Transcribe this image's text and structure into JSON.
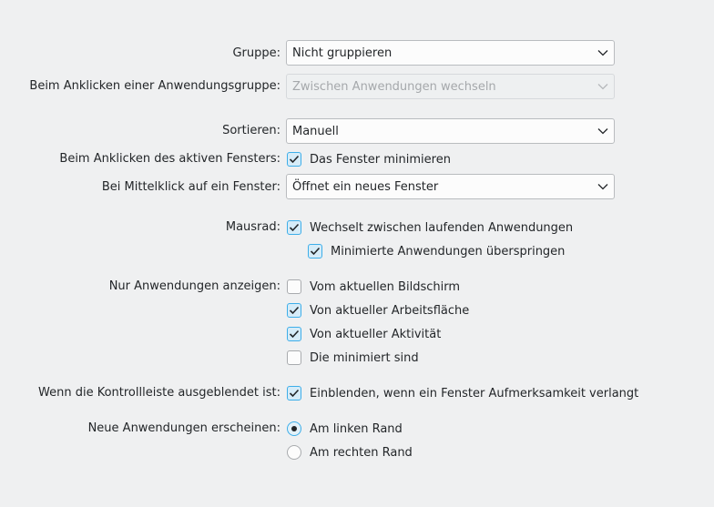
{
  "grouping": {
    "label": "Gruppe:",
    "value": "Nicht gruppieren"
  },
  "group_click": {
    "label": "Beim Anklicken einer Anwendungsgruppe:",
    "value": "Zwischen Anwendungen wechseln",
    "enabled": false
  },
  "sorting": {
    "label": "Sortieren:",
    "value": "Manuell"
  },
  "active_window_click": {
    "label": "Beim Anklicken des aktiven Fensters:",
    "option": "Das Fenster minimieren",
    "checked": true
  },
  "middle_click": {
    "label": "Bei Mittelklick auf ein Fenster:",
    "value": "Öffnet ein neues Fenster"
  },
  "mouse_wheel": {
    "label": "Mausrad:",
    "cycle": {
      "text": "Wechselt zwischen laufenden Anwendungen",
      "checked": true
    },
    "skip_minimized": {
      "text": "Minimierte Anwendungen überspringen",
      "checked": true
    }
  },
  "filter": {
    "label": "Nur Anwendungen anzeigen:",
    "options": [
      {
        "text": "Vom aktuellen Bildschirm",
        "checked": false
      },
      {
        "text": "Von aktueller Arbeitsfläche",
        "checked": true
      },
      {
        "text": "Von aktueller Aktivität",
        "checked": true
      },
      {
        "text": "Die minimiert sind",
        "checked": false
      }
    ]
  },
  "hidden_panel": {
    "label": "Wenn die Kontrollleiste ausgeblendet ist:",
    "option": "Einblenden, wenn ein Fenster Aufmerksamkeit verlangt",
    "checked": true
  },
  "new_apps": {
    "label": "Neue Anwendungen erscheinen:",
    "options": [
      {
        "text": "Am linken Rand",
        "checked": true
      },
      {
        "text": "Am rechten Rand",
        "checked": false
      }
    ]
  },
  "colors": {
    "accent": "#3daee9",
    "background": "#eff0f1"
  }
}
